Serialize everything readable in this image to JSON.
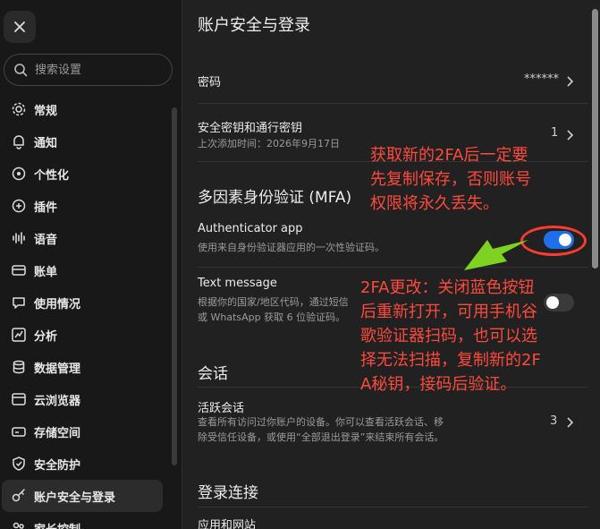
{
  "sidebar": {
    "search_placeholder": "搜索设置",
    "items": [
      {
        "label": "常规",
        "icon": "gear-icon"
      },
      {
        "label": "通知",
        "icon": "bell-icon"
      },
      {
        "label": "个性化",
        "icon": "palette-icon"
      },
      {
        "label": "插件",
        "icon": "plugin-icon"
      },
      {
        "label": "语音",
        "icon": "waveform-icon"
      },
      {
        "label": "账单",
        "icon": "card-icon"
      },
      {
        "label": "使用情况",
        "icon": "chat-icon"
      },
      {
        "label": "分析",
        "icon": "chart-icon"
      },
      {
        "label": "数据管理",
        "icon": "database-icon"
      },
      {
        "label": "云浏览器",
        "icon": "browser-icon"
      },
      {
        "label": "存储空间",
        "icon": "storage-icon"
      },
      {
        "label": "安全防护",
        "icon": "shield-icon"
      },
      {
        "label": "账户安全与登录",
        "icon": "key-icon"
      },
      {
        "label": "家长控制",
        "icon": "family-icon"
      }
    ]
  },
  "main": {
    "title": "账户安全与登录",
    "password": {
      "label": "密码",
      "value": "******"
    },
    "passkeys": {
      "label": "安全密钥和通行密钥",
      "sub": "上次添加时间：2026年9月17日",
      "value": "1"
    },
    "mfa_title": "多因素身份验证 (MFA)",
    "authenticator": {
      "label": "Authenticator app",
      "sub": "使用来自身份验证器应用的一次性验证码。",
      "enabled": true
    },
    "sms": {
      "label": "Text message",
      "sub1": "根据你的国家/地区代码，通过短信",
      "sub2": "或 WhatsApp 获取 6 位验证码。",
      "enabled": false
    },
    "sessions_title": "会话",
    "active_sessions": {
      "label": "活跃会话",
      "sub1": "查看所有访问过你账户的设备。你可以查看活跃会话、移",
      "sub2": "除受信任设备，或使用“全部退出登录”来结束所有会话。",
      "value": "3"
    },
    "login_title": "登录连接",
    "apps_label": "应用和网站"
  },
  "annotations": {
    "note1": [
      "获取新的2FA后一定要",
      "先复制保存，否则账号",
      "权限将永久丢失。"
    ],
    "note2": [
      "2FA更改：关闭蓝色按钮",
      "后重新打开，可用手机谷",
      "歌验证器扫码，也可以选",
      "择无法扫描，复制新的2F",
      "A秘钥，接码后验证。"
    ],
    "color": "#ff4a3d",
    "arrow_color": "#7ed321"
  }
}
